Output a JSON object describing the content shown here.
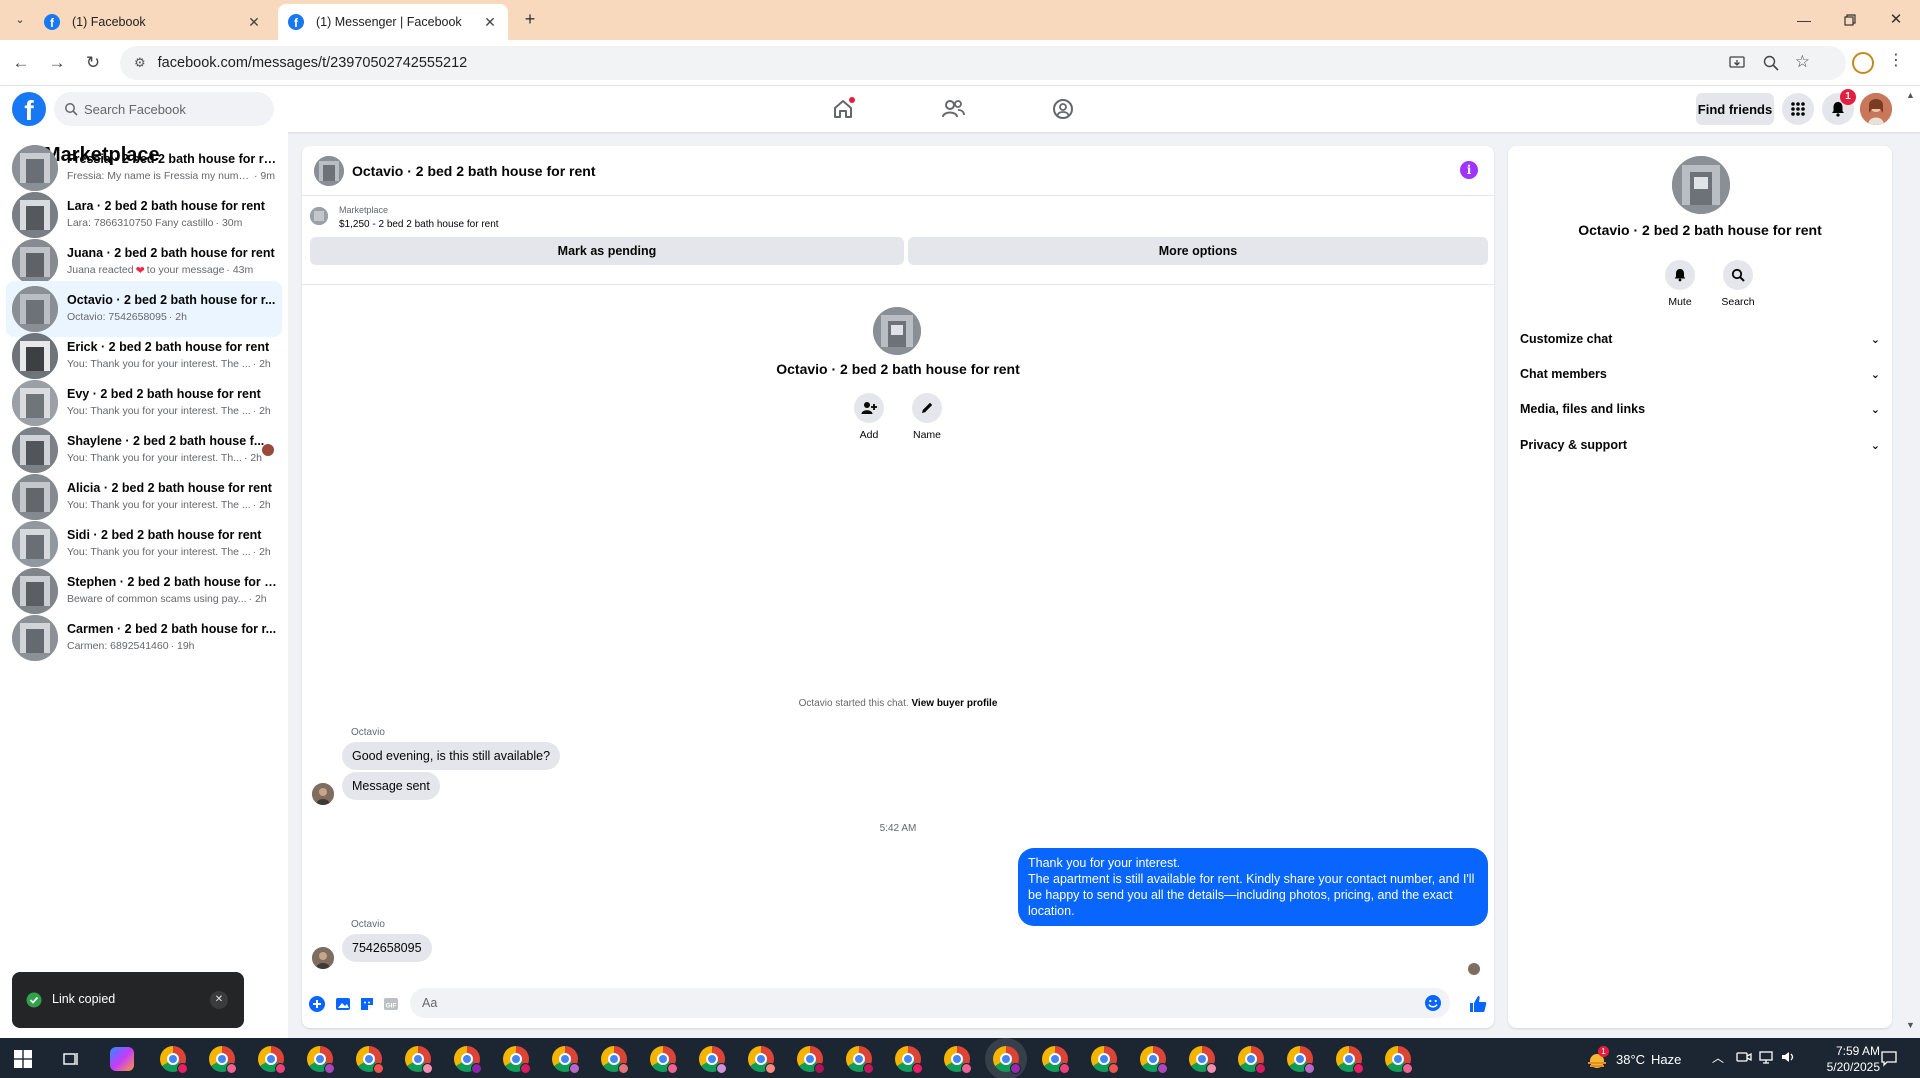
{
  "browser": {
    "tabs": [
      {
        "title": "(1) Facebook",
        "active": false
      },
      {
        "title": "(1) Messenger | Facebook",
        "active": true
      }
    ],
    "url": "facebook.com/messages/t/23970502742555212"
  },
  "fb_header": {
    "search_placeholder": "Search Facebook",
    "find_friends": "Find friends",
    "notification_count": "1"
  },
  "sidebar": {
    "title": "Marketplace",
    "conversations": [
      {
        "name": "Fressia · 2 bed 2 bath house for rent",
        "snippet": "Fressia: My name is Fressia my numb...",
        "time": " · 9m",
        "active": false
      },
      {
        "name": "Lara · 2 bed 2 bath house for rent",
        "snippet": "Lara: 7866310750 Fany castillo",
        "time": " · 30m",
        "active": false
      },
      {
        "name": "Juana · 2 bed 2 bath house for rent",
        "snippet": "Juana reacted",
        "snippet2": " to your message",
        "time": " · 43m",
        "active": false
      },
      {
        "name": "Octavio · 2 bed 2 bath house for r...",
        "snippet": "Octavio: 7542658095",
        "time": " · 2h",
        "active": true
      },
      {
        "name": "Erick · 2 bed 2 bath house for rent",
        "snippet": "You: Thank you for your interest. The ...",
        "time": " · 2h",
        "active": false
      },
      {
        "name": "Evy · 2 bed 2 bath house for rent",
        "snippet": "You: Thank you for your interest. The ...",
        "time": " · 2h",
        "active": false
      },
      {
        "name": "Shaylene · 2 bed 2 bath house f...",
        "snippet": "You: Thank you for your interest. Th...",
        "time": " · 2h",
        "active": false
      },
      {
        "name": "Alicia · 2 bed 2 bath house for rent",
        "snippet": "You: Thank you for your interest. The ...",
        "time": " · 2h",
        "active": false
      },
      {
        "name": "Sidi · 2 bed 2 bath house for rent",
        "snippet": "You: Thank you for your interest. The ...",
        "time": " · 2h",
        "active": false
      },
      {
        "name": "Stephen · 2 bed 2 bath house for r...",
        "snippet": "Beware of common scams using pay...",
        "time": " · 2h",
        "active": false
      },
      {
        "name": "Carmen · 2 bed 2 bath house for r...",
        "snippet": "Carmen: 6892541460",
        "time": " · 19h",
        "active": false
      }
    ]
  },
  "chat": {
    "title": "Octavio · 2 bed 2 bath house for rent",
    "marketplace_label": "Marketplace",
    "listing": "$1,250 - 2 bed 2 bath house for rent",
    "mark_pending": "Mark as pending",
    "more_options": "More options",
    "intro_name": "Octavio · 2 bed 2 bath house for rent",
    "add_label": "Add",
    "name_label": "Name",
    "started_text": "Octavio started this chat. ",
    "view_buyer_profile": "View buyer profile",
    "sender_name": "Octavio",
    "msg1": "Good evening, is this still available?",
    "msg2": "Message sent",
    "timestamp": "5:42 AM",
    "out_line1": "Thank you for your interest.",
    "out_line2": "The apartment is still available for rent. Kindly share your contact number, and I'll be happy to send you all the details—including photos, pricing, and the exact location.",
    "sender_name2": "Octavio",
    "msg3": "7542658095",
    "input_placeholder": "Aa"
  },
  "details": {
    "title": "Octavio · 2 bed 2 bath house for rent",
    "mute": "Mute",
    "search": "Search",
    "sections": [
      "Customize chat",
      "Chat members",
      "Media, files and links",
      "Privacy & support"
    ]
  },
  "toast": {
    "text": "Link copied"
  },
  "taskbar": {
    "weather_temp": "38°C",
    "weather_desc": "Haze",
    "time": "7:59 AM",
    "date": "5/20/2025",
    "weather_badge": "1"
  },
  "colors": {
    "fb_blue": "#1877f2",
    "out_bubble": "#0866ff",
    "tab_bar": "#f9d9bd",
    "info_purple": "#a033ff"
  }
}
